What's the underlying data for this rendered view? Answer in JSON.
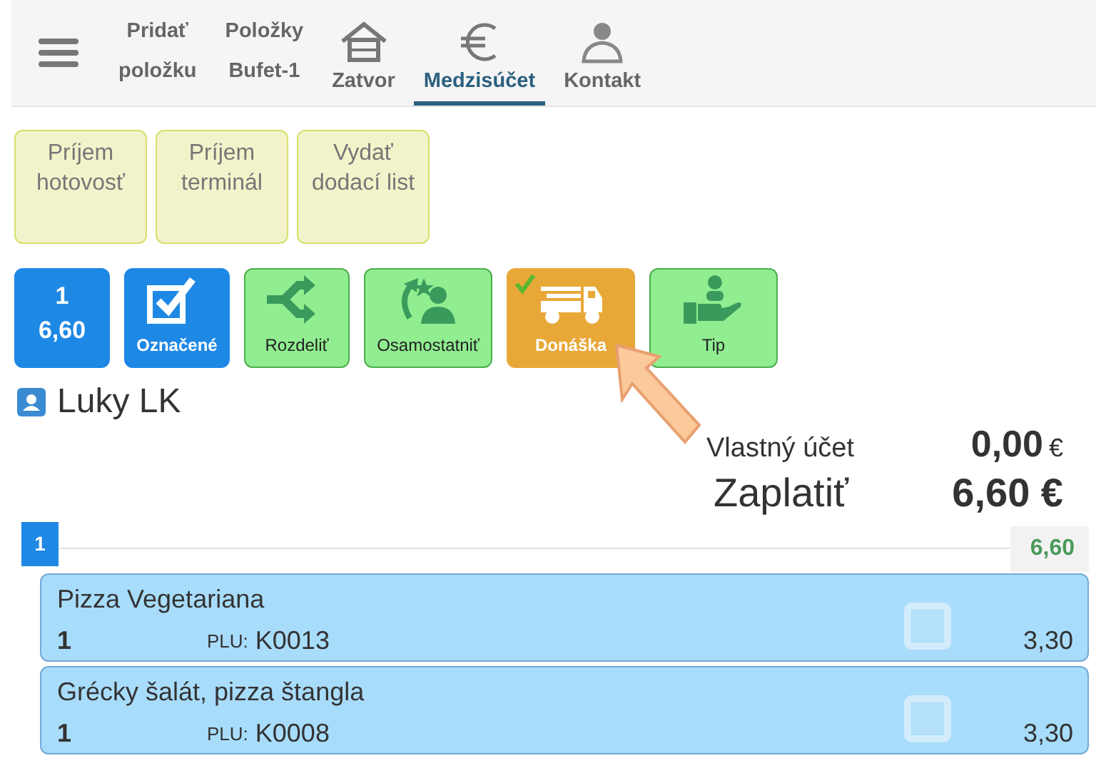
{
  "tabs": [
    {
      "kind": "text",
      "lines": [
        "Pridať",
        "položku"
      ],
      "selected": false
    },
    {
      "kind": "text",
      "lines": [
        "Položky",
        "Bufet-1"
      ],
      "selected": false
    },
    {
      "kind": "icon",
      "lines": [
        "Zatvor"
      ],
      "selected": false
    },
    {
      "kind": "icon",
      "lines": [
        "Medzisúčet"
      ],
      "selected": true
    },
    {
      "kind": "icon",
      "lines": [
        "Kontakt"
      ],
      "selected": false
    }
  ],
  "payments": [
    {
      "lines": [
        "Príjem",
        "hotovosť"
      ]
    },
    {
      "lines": [
        "Príjem",
        "terminál"
      ]
    },
    {
      "lines": [
        "Vydať",
        "dodací list"
      ]
    }
  ],
  "actions": [
    {
      "kind": "counter",
      "lines": [
        "1",
        "6,60"
      ],
      "color": "#1e88e5",
      "active": false
    },
    {
      "kind": "tool",
      "label": "Označené",
      "color": "#1e88e5",
      "active": false
    },
    {
      "kind": "tool",
      "label": "Rozdeliť",
      "color": "#90ee90",
      "active": false
    },
    {
      "kind": "tool",
      "label": "Osamostatniť",
      "color": "#90ee90",
      "active": false
    },
    {
      "kind": "tool",
      "label": "Donáška",
      "color": "#e8a838",
      "active": true
    },
    {
      "kind": "tool",
      "label": "Tip",
      "color": "#90ee90",
      "active": false
    }
  ],
  "customer": {
    "name": "Luky LK"
  },
  "totals": [
    {
      "kind": "own",
      "label": "Vlastný účet",
      "amount": "0,00",
      "currency": "€"
    },
    {
      "kind": "due",
      "label": "Zaplatiť",
      "amount": "6,60 €"
    }
  ],
  "group": {
    "number": "1",
    "total": "6,60",
    "items": [
      {
        "name": "Pizza Vegetariana",
        "qty": "1",
        "plu_label": "PLU:",
        "plu": "K0013",
        "price": "3,30",
        "checked": false
      },
      {
        "name": "Grécky šalát, pizza štangla",
        "qty": "1",
        "plu_label": "PLU:",
        "plu": "K0008",
        "price": "3,30",
        "checked": false
      }
    ]
  }
}
